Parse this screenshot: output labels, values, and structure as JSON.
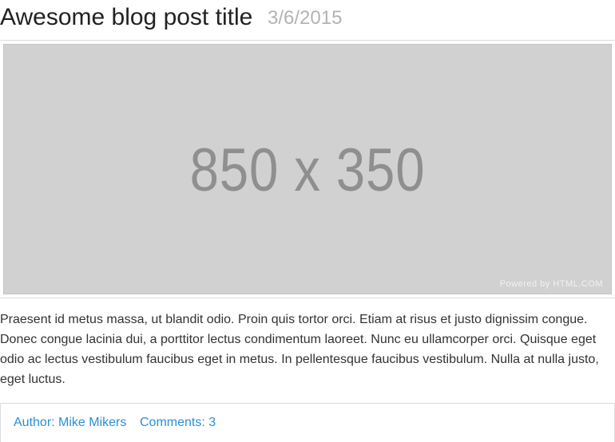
{
  "post": {
    "title": "Awesome blog post title",
    "date": "3/6/2015",
    "image": {
      "placeholder_text": "850 x 350",
      "powered_by": "Powered by HTML.COM"
    },
    "body": "Praesent id metus massa, ut blandit odio. Proin quis tortor orci. Etiam at risus et justo dignissim congue. Donec congue lacinia dui, a porttitor lectus condimentum laoreet. Nunc eu ullamcorper orci. Quisque eget odio ac lectus vestibulum faucibus eget in metus. In pellentesque faucibus vestibulum. Nulla at nulla justo, eget luctus.",
    "meta": {
      "author": "Author: Mike Mikers",
      "comments": "Comments: 3"
    }
  },
  "colors": {
    "link": "#2a8fd8",
    "date": "#b3b3b3",
    "placeholder_bg": "#d1d1d1"
  }
}
